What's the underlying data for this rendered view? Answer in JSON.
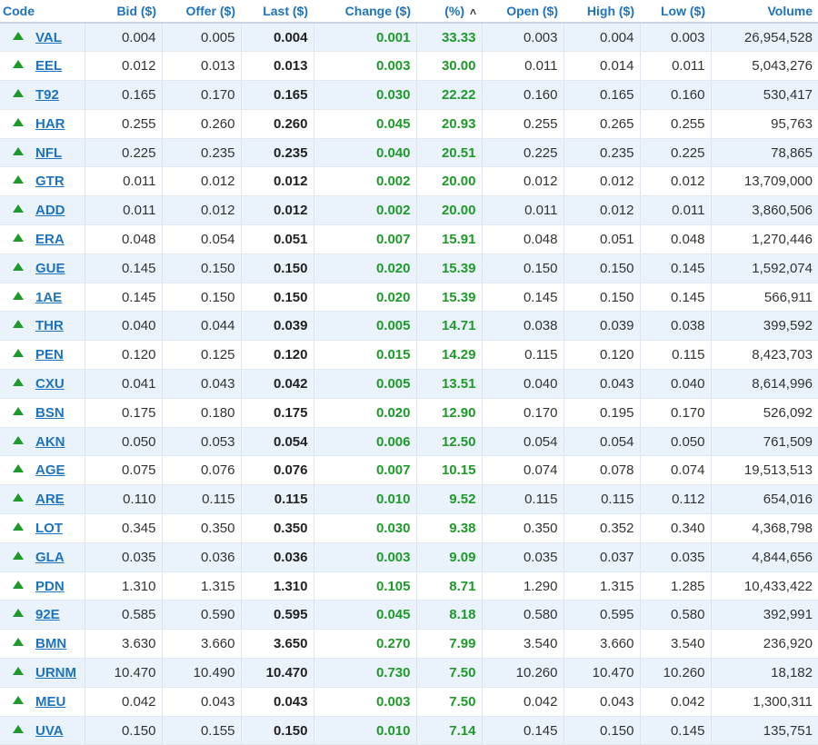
{
  "columns": {
    "code": "Code",
    "bid": "Bid ($)",
    "offer": "Offer ($)",
    "last": "Last ($)",
    "change": "Change ($)",
    "pct": "(%)",
    "open": "Open ($)",
    "high": "High ($)",
    "low": "Low ($)",
    "volume": "Volume"
  },
  "sort": {
    "column": "pct",
    "direction": "descending",
    "icon": "chevron-up-icon"
  },
  "colors": {
    "header_text": "#1e73be",
    "positive": "#1e9a2a",
    "row_stripe": "#eaf3fb"
  },
  "rows": [
    {
      "code": "VAL",
      "bid": "0.004",
      "offer": "0.005",
      "last": "0.004",
      "change": "0.001",
      "pct": "33.33",
      "open": "0.003",
      "high": "0.004",
      "low": "0.003",
      "volume": "26,954,528"
    },
    {
      "code": "EEL",
      "bid": "0.012",
      "offer": "0.013",
      "last": "0.013",
      "change": "0.003",
      "pct": "30.00",
      "open": "0.011",
      "high": "0.014",
      "low": "0.011",
      "volume": "5,043,276"
    },
    {
      "code": "T92",
      "bid": "0.165",
      "offer": "0.170",
      "last": "0.165",
      "change": "0.030",
      "pct": "22.22",
      "open": "0.160",
      "high": "0.165",
      "low": "0.160",
      "volume": "530,417"
    },
    {
      "code": "HAR",
      "bid": "0.255",
      "offer": "0.260",
      "last": "0.260",
      "change": "0.045",
      "pct": "20.93",
      "open": "0.255",
      "high": "0.265",
      "low": "0.255",
      "volume": "95,763"
    },
    {
      "code": "NFL",
      "bid": "0.225",
      "offer": "0.235",
      "last": "0.235",
      "change": "0.040",
      "pct": "20.51",
      "open": "0.225",
      "high": "0.235",
      "low": "0.225",
      "volume": "78,865"
    },
    {
      "code": "GTR",
      "bid": "0.011",
      "offer": "0.012",
      "last": "0.012",
      "change": "0.002",
      "pct": "20.00",
      "open": "0.012",
      "high": "0.012",
      "low": "0.012",
      "volume": "13,709,000"
    },
    {
      "code": "ADD",
      "bid": "0.011",
      "offer": "0.012",
      "last": "0.012",
      "change": "0.002",
      "pct": "20.00",
      "open": "0.011",
      "high": "0.012",
      "low": "0.011",
      "volume": "3,860,506"
    },
    {
      "code": "ERA",
      "bid": "0.048",
      "offer": "0.054",
      "last": "0.051",
      "change": "0.007",
      "pct": "15.91",
      "open": "0.048",
      "high": "0.051",
      "low": "0.048",
      "volume": "1,270,446"
    },
    {
      "code": "GUE",
      "bid": "0.145",
      "offer": "0.150",
      "last": "0.150",
      "change": "0.020",
      "pct": "15.39",
      "open": "0.150",
      "high": "0.150",
      "low": "0.145",
      "volume": "1,592,074"
    },
    {
      "code": "1AE",
      "bid": "0.145",
      "offer": "0.150",
      "last": "0.150",
      "change": "0.020",
      "pct": "15.39",
      "open": "0.145",
      "high": "0.150",
      "low": "0.145",
      "volume": "566,911"
    },
    {
      "code": "THR",
      "bid": "0.040",
      "offer": "0.044",
      "last": "0.039",
      "change": "0.005",
      "pct": "14.71",
      "open": "0.038",
      "high": "0.039",
      "low": "0.038",
      "volume": "399,592"
    },
    {
      "code": "PEN",
      "bid": "0.120",
      "offer": "0.125",
      "last": "0.120",
      "change": "0.015",
      "pct": "14.29",
      "open": "0.115",
      "high": "0.120",
      "low": "0.115",
      "volume": "8,423,703"
    },
    {
      "code": "CXU",
      "bid": "0.041",
      "offer": "0.043",
      "last": "0.042",
      "change": "0.005",
      "pct": "13.51",
      "open": "0.040",
      "high": "0.043",
      "low": "0.040",
      "volume": "8,614,996"
    },
    {
      "code": "BSN",
      "bid": "0.175",
      "offer": "0.180",
      "last": "0.175",
      "change": "0.020",
      "pct": "12.90",
      "open": "0.170",
      "high": "0.195",
      "low": "0.170",
      "volume": "526,092"
    },
    {
      "code": "AKN",
      "bid": "0.050",
      "offer": "0.053",
      "last": "0.054",
      "change": "0.006",
      "pct": "12.50",
      "open": "0.054",
      "high": "0.054",
      "low": "0.050",
      "volume": "761,509"
    },
    {
      "code": "AGE",
      "bid": "0.075",
      "offer": "0.076",
      "last": "0.076",
      "change": "0.007",
      "pct": "10.15",
      "open": "0.074",
      "high": "0.078",
      "low": "0.074",
      "volume": "19,513,513"
    },
    {
      "code": "ARE",
      "bid": "0.110",
      "offer": "0.115",
      "last": "0.115",
      "change": "0.010",
      "pct": "9.52",
      "open": "0.115",
      "high": "0.115",
      "low": "0.112",
      "volume": "654,016"
    },
    {
      "code": "LOT",
      "bid": "0.345",
      "offer": "0.350",
      "last": "0.350",
      "change": "0.030",
      "pct": "9.38",
      "open": "0.350",
      "high": "0.352",
      "low": "0.340",
      "volume": "4,368,798"
    },
    {
      "code": "GLA",
      "bid": "0.035",
      "offer": "0.036",
      "last": "0.036",
      "change": "0.003",
      "pct": "9.09",
      "open": "0.035",
      "high": "0.037",
      "low": "0.035",
      "volume": "4,844,656"
    },
    {
      "code": "PDN",
      "bid": "1.310",
      "offer": "1.315",
      "last": "1.310",
      "change": "0.105",
      "pct": "8.71",
      "open": "1.290",
      "high": "1.315",
      "low": "1.285",
      "volume": "10,433,422"
    },
    {
      "code": "92E",
      "bid": "0.585",
      "offer": "0.590",
      "last": "0.595",
      "change": "0.045",
      "pct": "8.18",
      "open": "0.580",
      "high": "0.595",
      "low": "0.580",
      "volume": "392,991"
    },
    {
      "code": "BMN",
      "bid": "3.630",
      "offer": "3.660",
      "last": "3.650",
      "change": "0.270",
      "pct": "7.99",
      "open": "3.540",
      "high": "3.660",
      "low": "3.540",
      "volume": "236,920"
    },
    {
      "code": "URNM",
      "bid": "10.470",
      "offer": "10.490",
      "last": "10.470",
      "change": "0.730",
      "pct": "7.50",
      "open": "10.260",
      "high": "10.470",
      "low": "10.260",
      "volume": "18,182"
    },
    {
      "code": "MEU",
      "bid": "0.042",
      "offer": "0.043",
      "last": "0.043",
      "change": "0.003",
      "pct": "7.50",
      "open": "0.042",
      "high": "0.043",
      "low": "0.042",
      "volume": "1,300,311"
    },
    {
      "code": "UVA",
      "bid": "0.150",
      "offer": "0.155",
      "last": "0.150",
      "change": "0.010",
      "pct": "7.14",
      "open": "0.145",
      "high": "0.150",
      "low": "0.145",
      "volume": "135,751"
    }
  ]
}
